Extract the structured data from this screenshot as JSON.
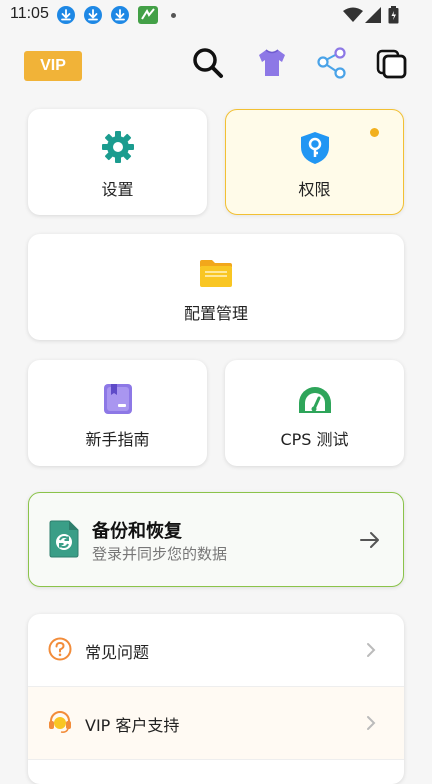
{
  "status": {
    "time": "11:05"
  },
  "header": {
    "vip_badge": "VIP",
    "icons": [
      "search-icon",
      "tshirt-icon",
      "share-icon",
      "copy-icon"
    ]
  },
  "tiles": {
    "settings": {
      "label": "设置",
      "icon": "gear-icon"
    },
    "permissions": {
      "label": "权限",
      "icon": "shield-key-icon"
    },
    "config": {
      "label": "配置管理",
      "icon": "folder-icon"
    },
    "guide": {
      "label": "新手指南",
      "icon": "book-icon"
    },
    "cps": {
      "label": "CPS 测试",
      "icon": "speedometer-icon"
    }
  },
  "backup": {
    "title": "备份和恢复",
    "subtitle": "登录并同步您的数据",
    "icon": "sync-document-icon"
  },
  "list": {
    "items": [
      {
        "label": "常见问题",
        "icon": "help-circle-icon"
      },
      {
        "label": "VIP 客户支持",
        "icon": "headset-icon"
      }
    ]
  },
  "colors": {
    "accent_gold": "#f1b338",
    "teal": "#1b9c8f",
    "blue": "#2196f3",
    "green": "#8bc34a",
    "orange": "#f28c3a"
  }
}
